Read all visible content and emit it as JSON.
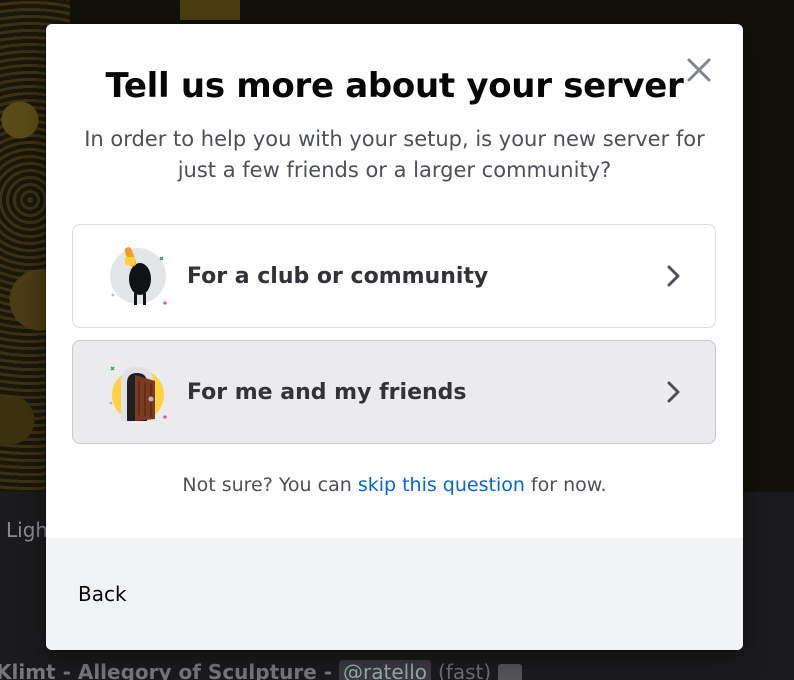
{
  "background": {
    "strip_text": "Ligh",
    "bottom_text": "Klimt - Allegory of Sculpture -",
    "bottom_handle": "@ratello",
    "bottom_suffix": "(fast)"
  },
  "modal": {
    "title": "Tell us more about your server",
    "subtitle": "In order to help you with your setup, is your new server for just a few friends or a larger community?",
    "options": [
      {
        "label": "For a club or community",
        "icon": "club-community-illustration",
        "chevron": "chevron-right-icon"
      },
      {
        "label": "For me and my friends",
        "icon": "friends-door-illustration",
        "chevron": "chevron-right-icon"
      }
    ],
    "skip": {
      "prefix": "Not sure? You can ",
      "link": "skip this question",
      "suffix": " for now."
    },
    "footer": {
      "back_label": "Back"
    },
    "close_icon": "close-icon"
  },
  "colors": {
    "title": "#060607",
    "body_text": "#4e5058",
    "link": "#0067e0",
    "footer_bg": "#f2f3f5",
    "hover_bg": "#ebebed"
  }
}
